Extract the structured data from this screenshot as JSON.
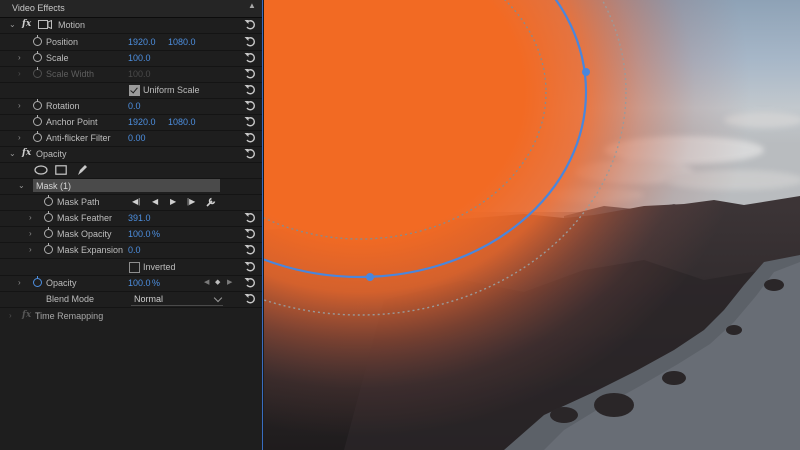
{
  "panel": {
    "title": "Video Effects",
    "motion": {
      "label": "Motion",
      "position": {
        "label": "Position",
        "x": "1920.0",
        "y": "1080.0"
      },
      "scale": {
        "label": "Scale",
        "value": "100.0"
      },
      "scale_width": {
        "label": "Scale Width",
        "value": "100.0"
      },
      "uniform_scale": {
        "label": "Uniform Scale",
        "checked": true
      },
      "rotation": {
        "label": "Rotation",
        "value": "0.0"
      },
      "anchor_point": {
        "label": "Anchor Point",
        "x": "1920.0",
        "y": "1080.0"
      },
      "anti_flicker": {
        "label": "Anti-flicker Filter",
        "value": "0.00"
      }
    },
    "opacity": {
      "label": "Opacity",
      "mask": {
        "label": "Mask (1)",
        "path_label": "Mask Path",
        "feather": {
          "label": "Mask Feather",
          "value": "391.0"
        },
        "opacity": {
          "label": "Mask Opacity",
          "value": "100.0",
          "unit": "%"
        },
        "expansion": {
          "label": "Mask Expansion",
          "value": "0.0"
        },
        "inverted": {
          "label": "Inverted",
          "checked": false
        }
      },
      "opacity_value": {
        "label": "Opacity",
        "value": "100.0",
        "unit": "%"
      },
      "blend_mode": {
        "label": "Blend Mode",
        "value": "Normal"
      }
    },
    "time_remapping": {
      "label": "Time Remapping"
    }
  },
  "colors": {
    "accent": "#4d8fe0",
    "panel_bg": "#1e1e1e",
    "mask_fill": "#f26a23",
    "mask_path": "#4a86dc"
  },
  "icons": [
    "chevron-right-icon",
    "chevron-down-icon",
    "fx-badge-icon",
    "stopwatch-icon",
    "reset-icon",
    "ellipse-mask-icon",
    "rectangle-mask-icon",
    "pen-tool-icon",
    "track-backward-icon",
    "step-backward-icon",
    "play-icon",
    "step-forward-icon",
    "wrench-icon",
    "add-keyframe-icon"
  ]
}
